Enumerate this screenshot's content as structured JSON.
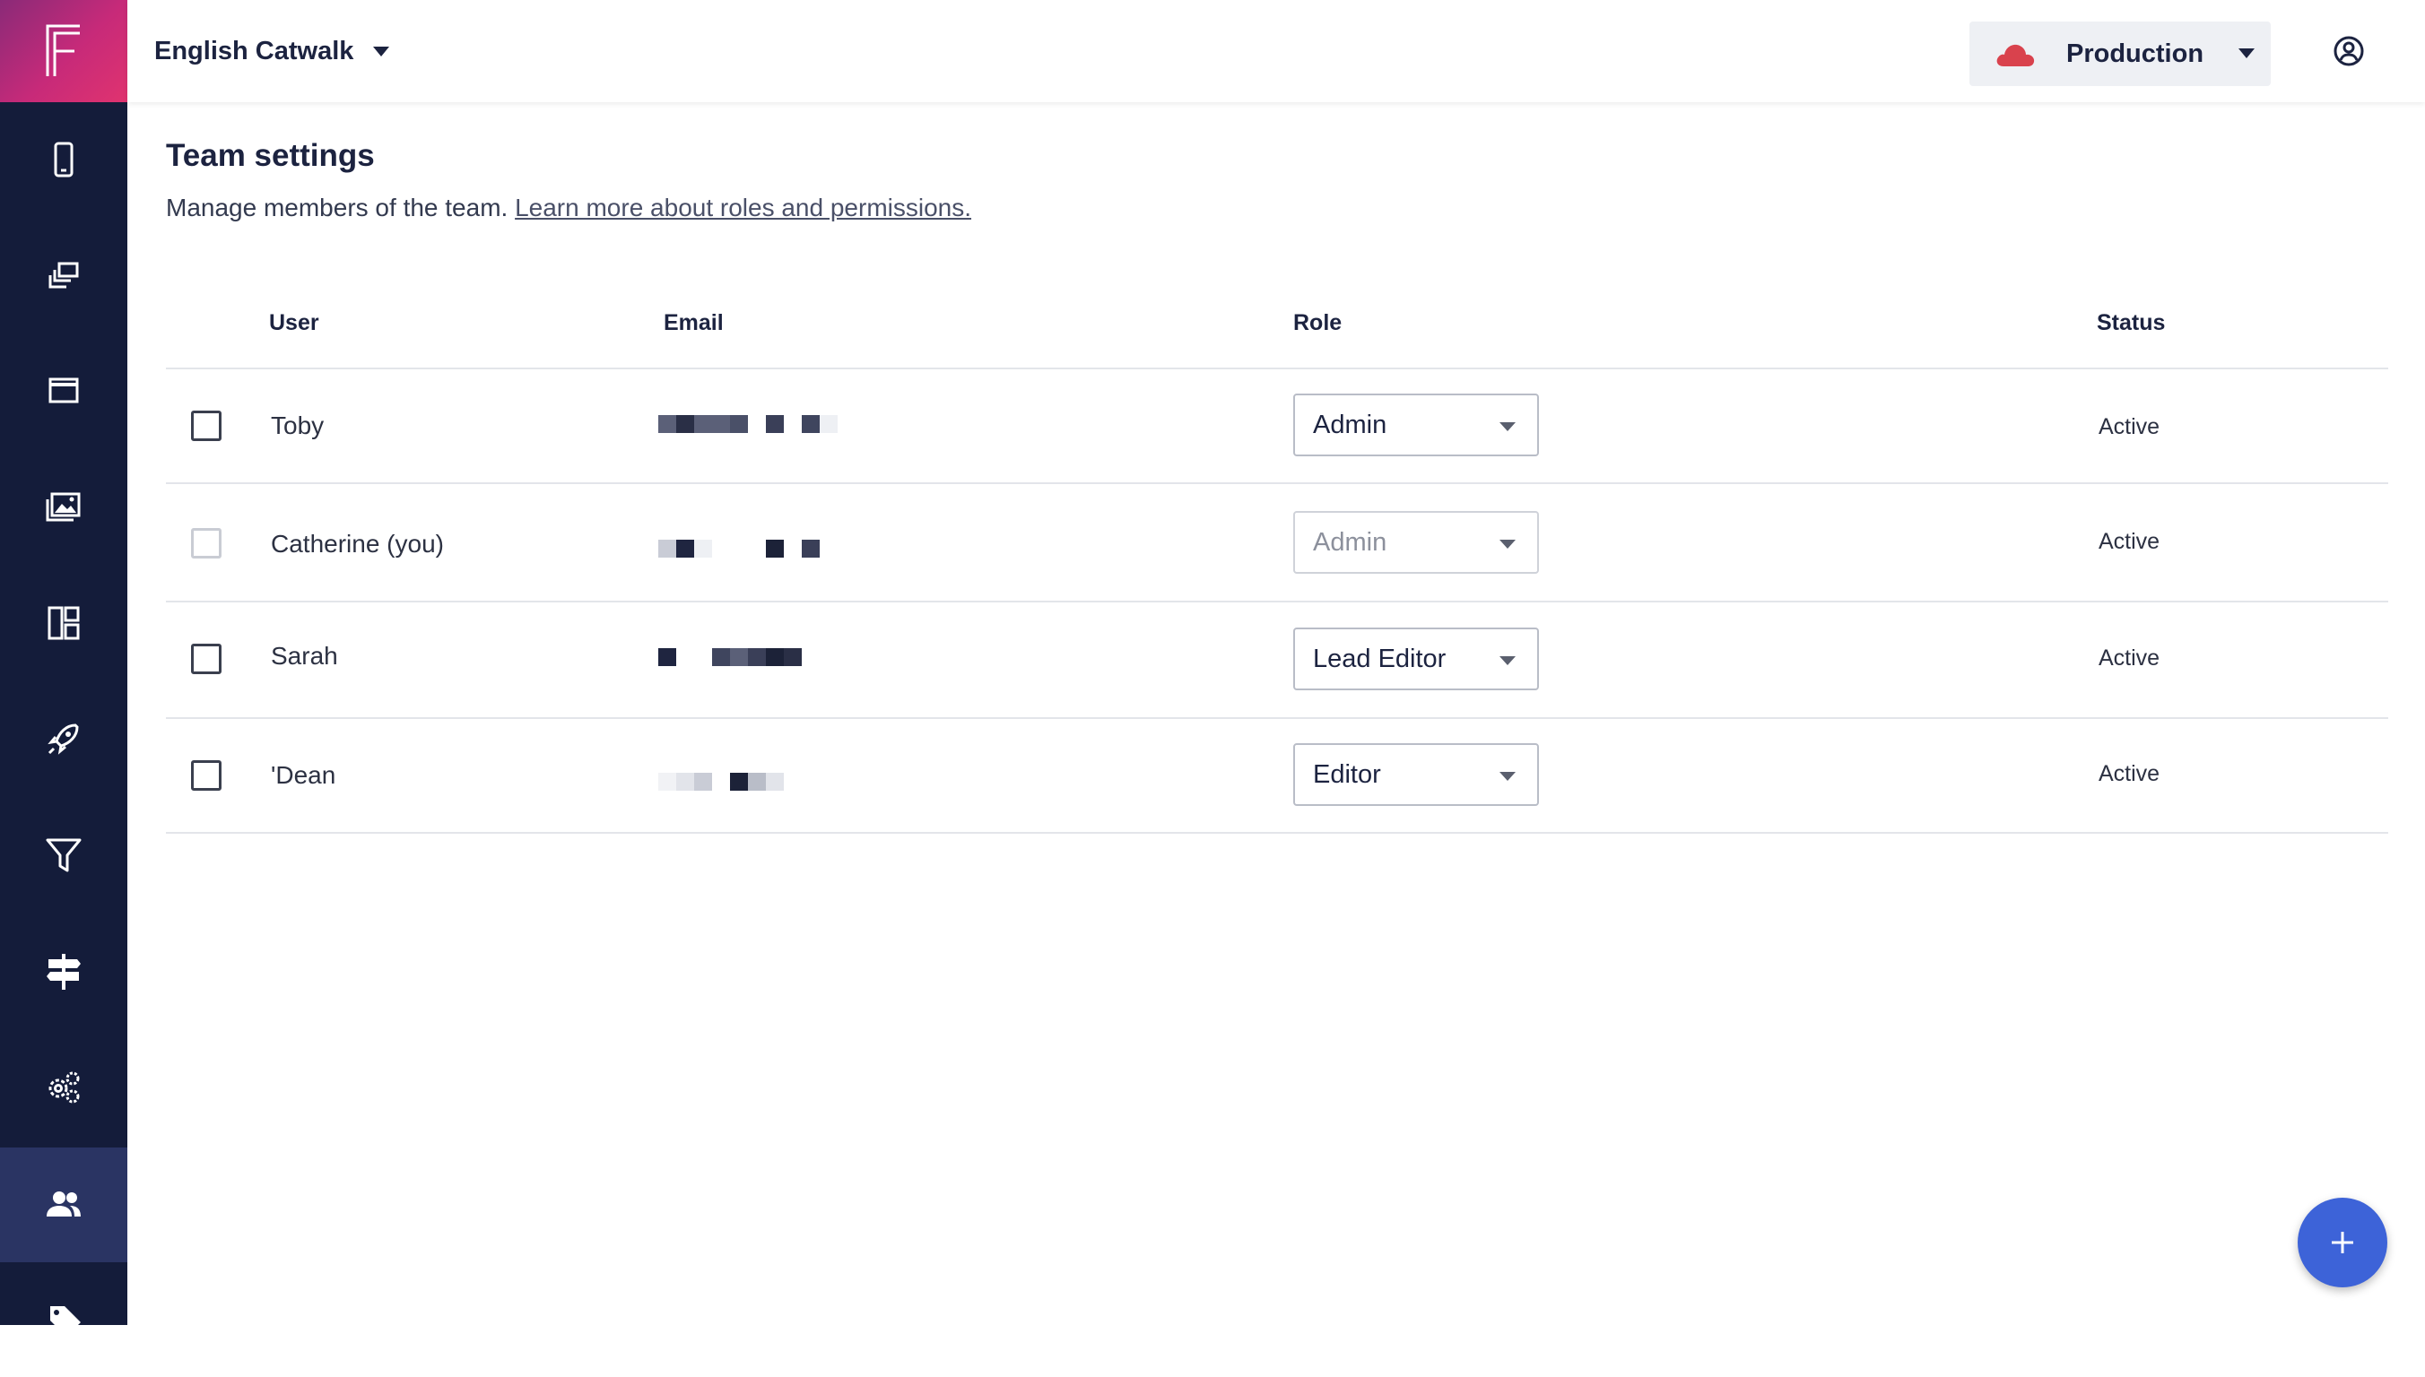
{
  "header": {
    "project_name": "English Catwalk",
    "environment": "Production"
  },
  "sidebar": {
    "items": [
      {
        "icon": "mobile-icon",
        "active": false
      },
      {
        "icon": "content-types-icon",
        "active": false
      },
      {
        "icon": "window-icon",
        "active": false
      },
      {
        "icon": "media-icon",
        "active": false
      },
      {
        "icon": "layout-icon",
        "active": false
      },
      {
        "icon": "rocket-icon",
        "active": false
      },
      {
        "icon": "filter-icon",
        "active": false
      },
      {
        "icon": "signpost-icon",
        "active": false
      },
      {
        "icon": "settings-gears-icon",
        "active": false
      },
      {
        "icon": "team-icon",
        "active": true
      },
      {
        "icon": "tag-icon",
        "active": false
      }
    ]
  },
  "page": {
    "title": "Team settings",
    "subtitle": "Manage members of the team.",
    "link_text": "Learn more about roles and permissions."
  },
  "table": {
    "headers": {
      "user": "User",
      "email": "Email",
      "role": "Role",
      "status": "Status"
    },
    "rows": [
      {
        "user": "Toby",
        "role": "Admin",
        "status": "Active",
        "role_disabled": false,
        "check_disabled": false
      },
      {
        "user": "Catherine (you)",
        "role": "Admin",
        "status": "Active",
        "role_disabled": true,
        "check_disabled": true
      },
      {
        "user": "Sarah",
        "role": "Lead Editor",
        "status": "Active",
        "role_disabled": false,
        "check_disabled": false
      },
      {
        "user": "'Dean",
        "role": "Editor",
        "status": "Active",
        "role_disabled": false,
        "check_disabled": false
      }
    ]
  },
  "colors": {
    "sidebar_bg": "#141c3a",
    "sidebar_active": "#2a3463",
    "accent_fab": "#3d63d8",
    "cloud": "#d9424d"
  }
}
